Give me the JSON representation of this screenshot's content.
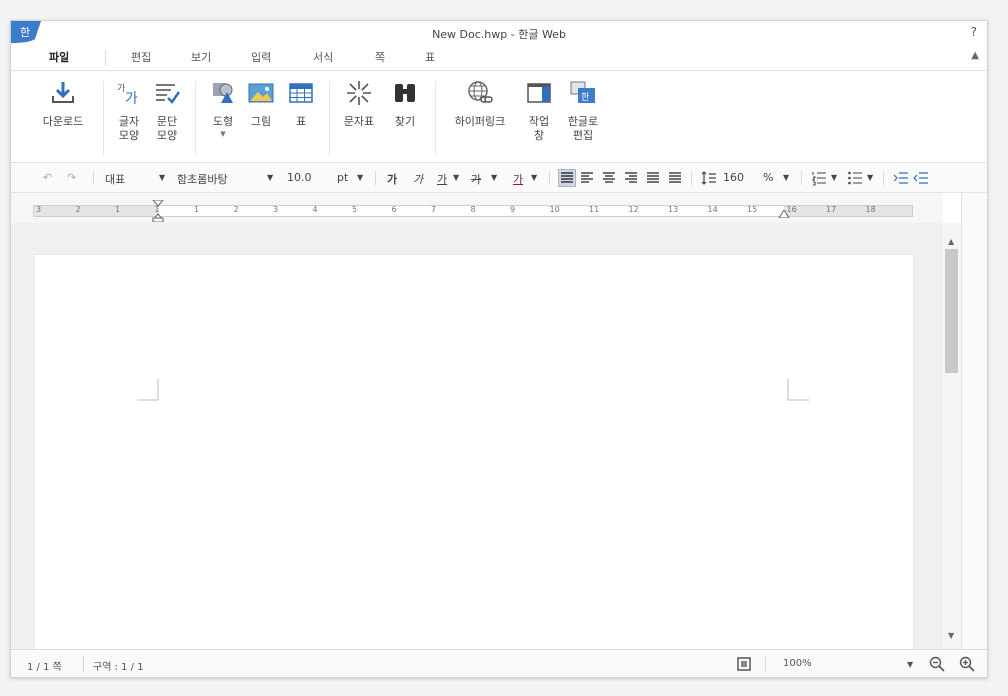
{
  "title": "New Doc.hwp - 한글 Web",
  "help_label": "?",
  "tabs": [
    {
      "label": "파일"
    },
    {
      "label": "편집"
    },
    {
      "label": "보기"
    },
    {
      "label": "입력"
    },
    {
      "label": "서식"
    },
    {
      "label": "쪽"
    },
    {
      "label": "표"
    }
  ],
  "ribbon": {
    "download": "다운로드",
    "char_shape_1": "글자",
    "char_shape_2": "모양",
    "para_shape_1": "문단",
    "para_shape_2": "모양",
    "shape": "도형",
    "picture": "그림",
    "table": "표",
    "symbol": "문자표",
    "find": "찾기",
    "hyperlink": "하이퍼링크",
    "taskpane_1": "작업",
    "taskpane_2": "창",
    "hangul_edit_1": "한글로",
    "hangul_edit_2": "편집"
  },
  "format": {
    "style": "대표",
    "font": "함초롬바탕",
    "size": "10.0",
    "size_unit": "pt",
    "bold": "가",
    "italic": "가",
    "underline": "가",
    "strike": "가",
    "color": "가",
    "line_spacing": "160",
    "line_spacing_unit": "%"
  },
  "ruler_numbers": [
    "3",
    "2",
    "1",
    "1",
    "1",
    "2",
    "3",
    "4",
    "5",
    "6",
    "7",
    "8",
    "9",
    "10",
    "11",
    "12",
    "13",
    "14",
    "15",
    "16",
    "17",
    "18"
  ],
  "status": {
    "page": "1 / 1 쪽",
    "section": "구역 : 1 / 1",
    "zoom": "100%"
  },
  "colors": {
    "accent": "#3d7cc9",
    "ribbon_icon_blue": "#2f6fc0"
  }
}
